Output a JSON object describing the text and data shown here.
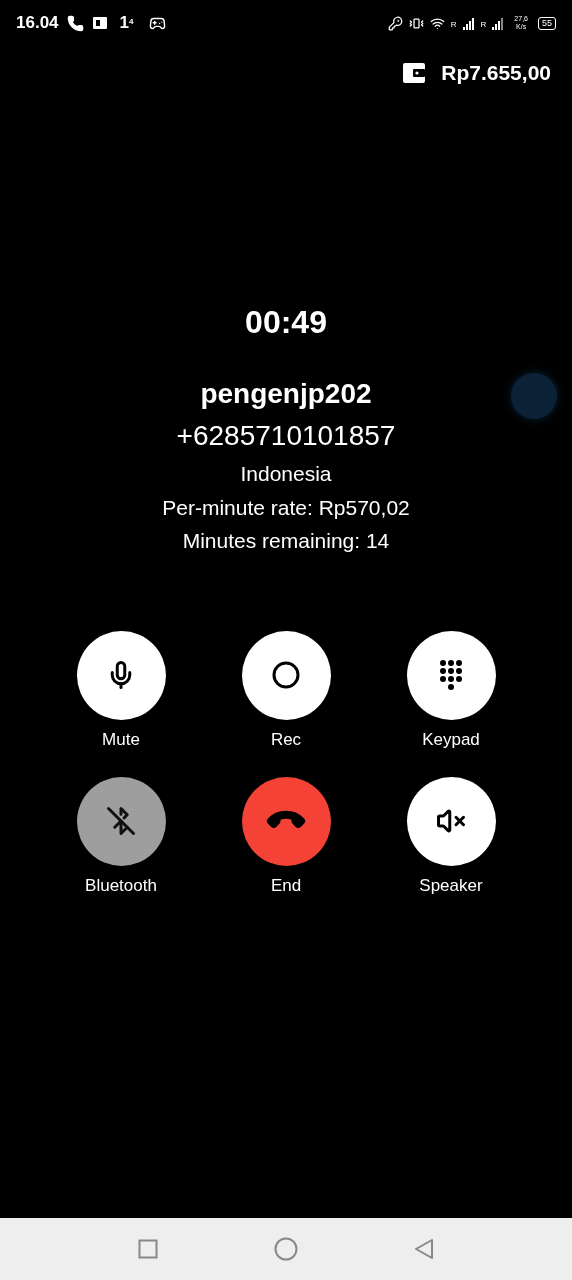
{
  "status_bar": {
    "time": "16.04",
    "sim_number": "1",
    "sim_sup": "4",
    "roaming_1": "R",
    "roaming_2": "R",
    "speed": "27,6",
    "speed_unit": "K/s",
    "battery": "55"
  },
  "balance": "Rp7.655,00",
  "call": {
    "timer": "00:49",
    "name": "pengenjp202",
    "number": "+6285710101857",
    "country": "Indonesia",
    "rate": "Per-minute rate: Rp570,02",
    "remaining": "Minutes remaining: 14"
  },
  "controls": [
    {
      "kind": "mic",
      "label": "Mute",
      "disabled": false
    },
    {
      "kind": "record",
      "label": "Rec",
      "disabled": false
    },
    {
      "kind": "keypad",
      "label": "Keypad",
      "disabled": false
    },
    {
      "kind": "bluetooth",
      "label": "Bluetooth",
      "disabled": true
    },
    {
      "kind": "end",
      "label": "End",
      "disabled": false
    },
    {
      "kind": "speaker",
      "label": "Speaker",
      "disabled": false
    }
  ]
}
